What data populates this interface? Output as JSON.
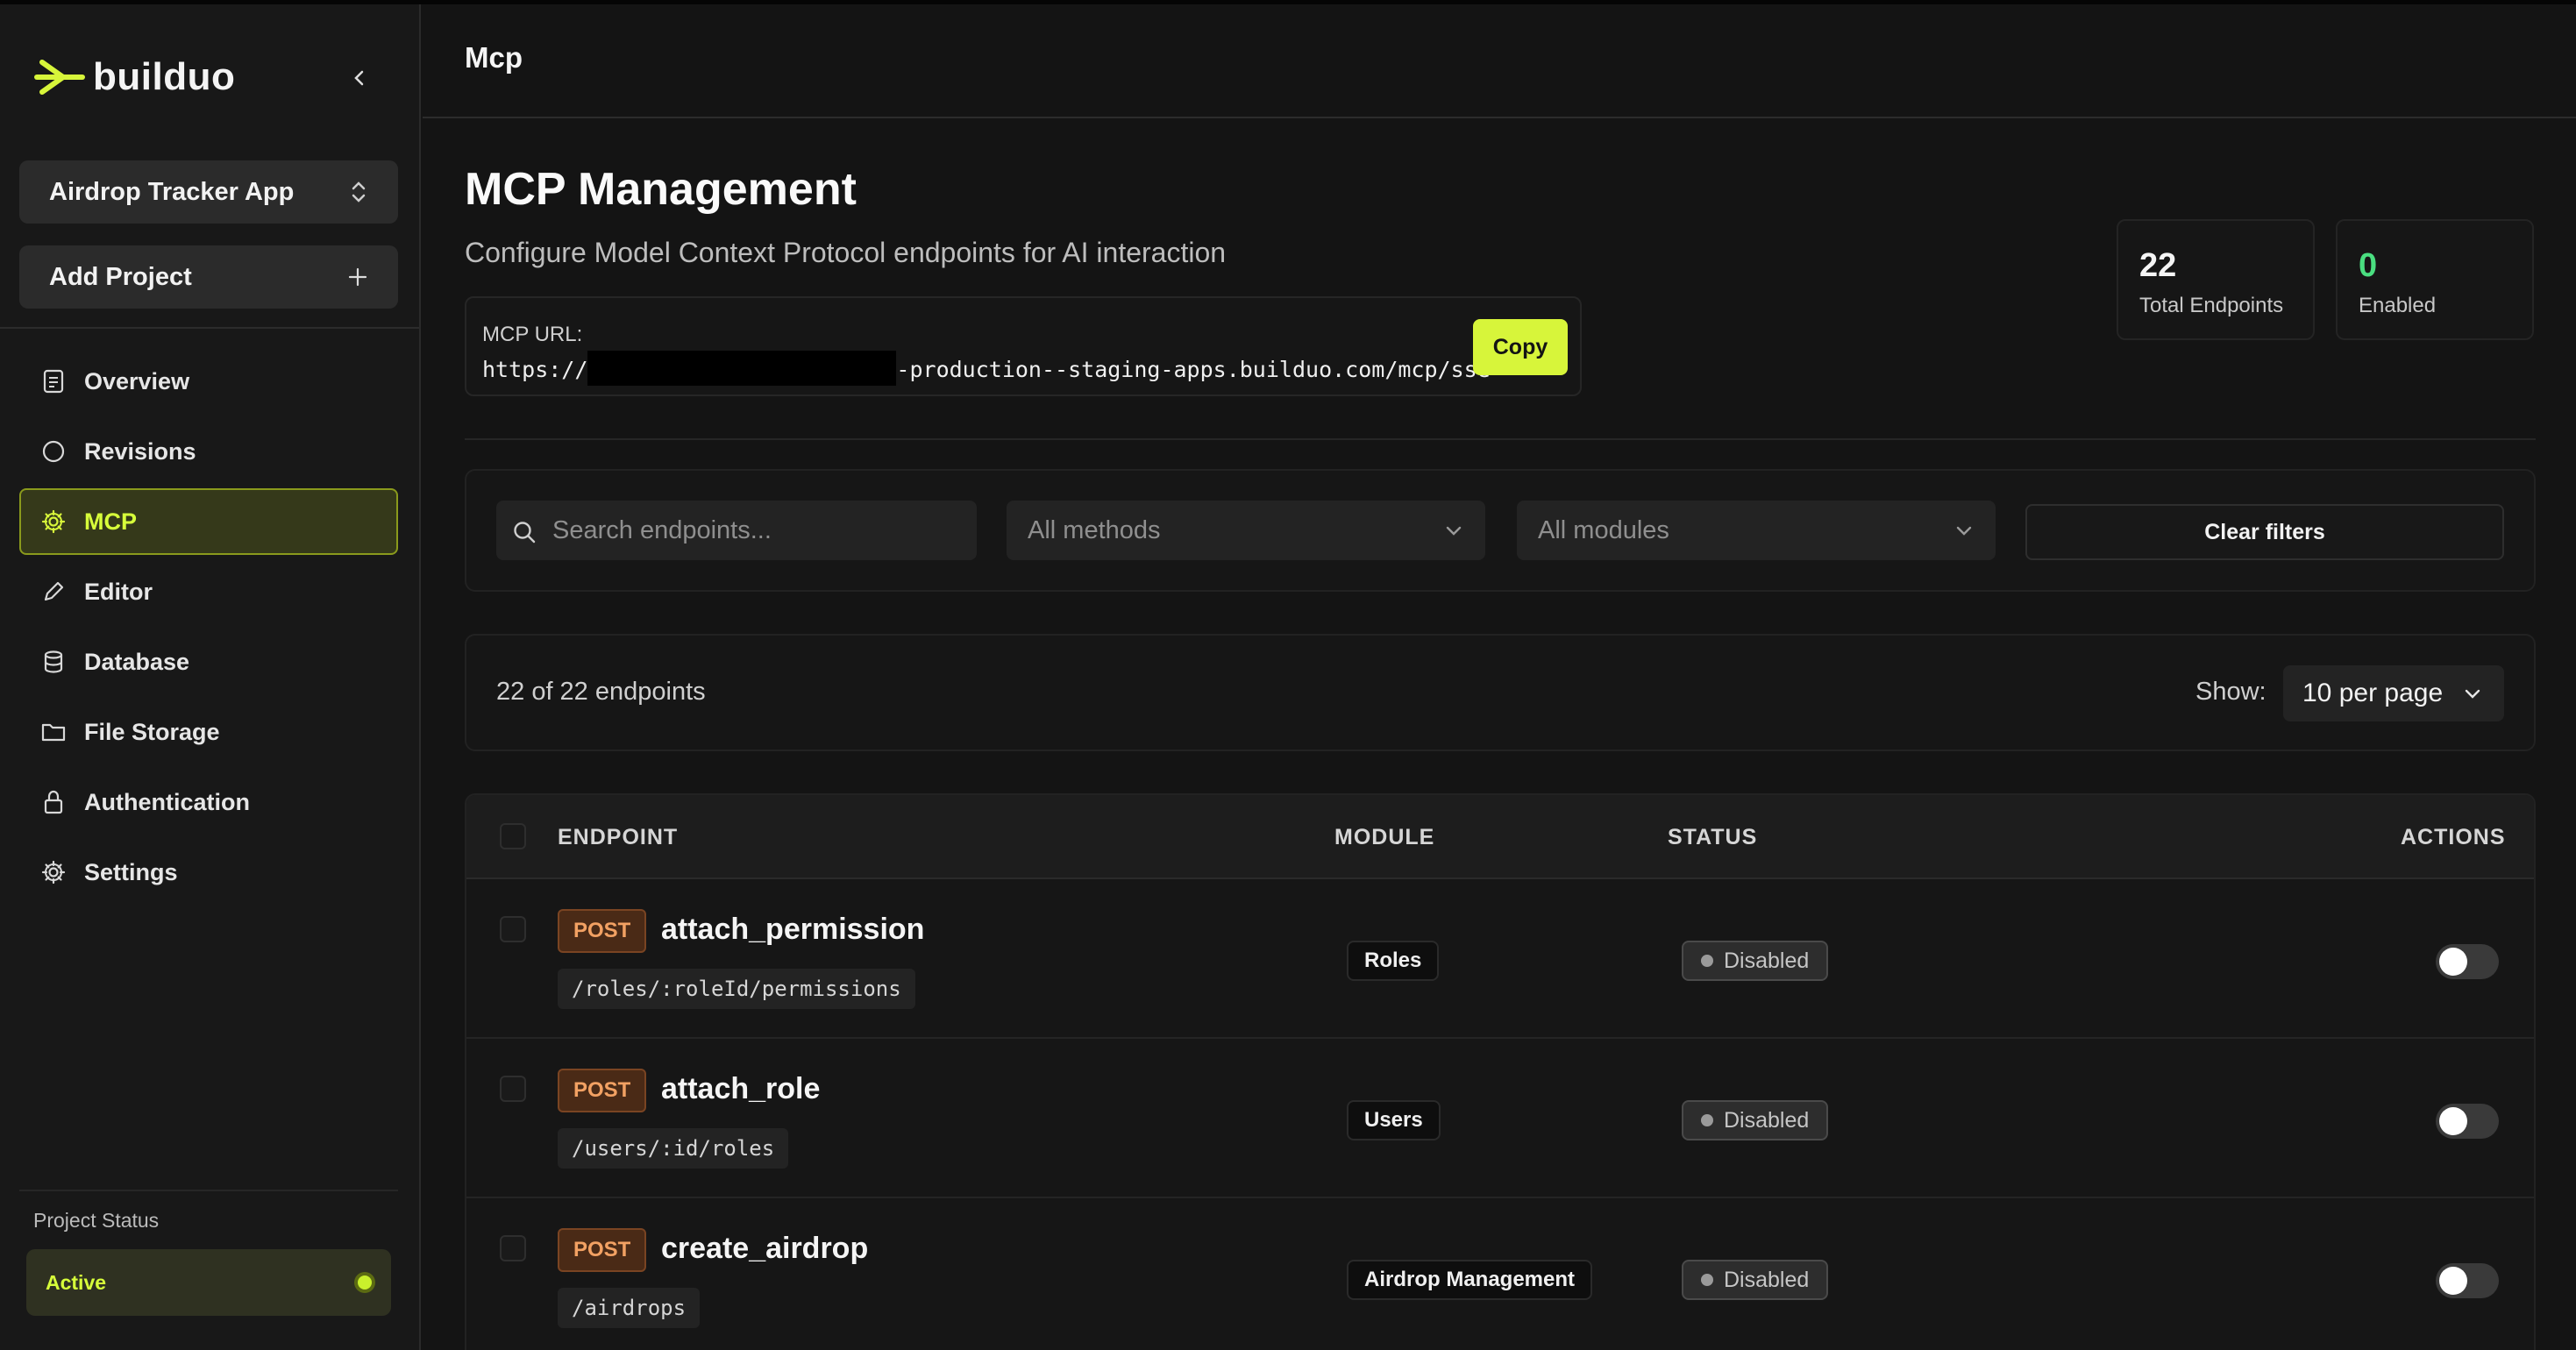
{
  "app": {
    "logo_text": "builduo"
  },
  "sidebar": {
    "project_selector": "Airdrop Tracker App",
    "add_project": "Add Project",
    "items": [
      {
        "label": "Overview",
        "icon": "document-icon"
      },
      {
        "label": "Revisions",
        "icon": "circle-icon"
      },
      {
        "label": "MCP",
        "icon": "gear-icon",
        "active": true
      },
      {
        "label": "Editor",
        "icon": "pencil-icon"
      },
      {
        "label": "Database",
        "icon": "database-icon"
      },
      {
        "label": "File Storage",
        "icon": "folder-icon"
      },
      {
        "label": "Authentication",
        "icon": "lock-icon"
      },
      {
        "label": "Settings",
        "icon": "gear-icon"
      }
    ],
    "project_status_label": "Project Status",
    "project_status_value": "Active"
  },
  "header": {
    "title": "Mcp"
  },
  "main": {
    "title": "MCP Management",
    "subtitle": "Configure Model Context Protocol endpoints for AI interaction",
    "mcp_url_label": "MCP URL:",
    "mcp_url_prefix": "https://",
    "mcp_url_suffix": "-production--staging-apps.builduo.com/mcp/sse",
    "copy_label": "Copy",
    "stats": {
      "total": {
        "value": "22",
        "label": "Total Endpoints"
      },
      "enabled": {
        "value": "0",
        "label": "Enabled"
      }
    }
  },
  "filters": {
    "search_placeholder": "Search endpoints...",
    "methods": "All methods",
    "modules": "All modules",
    "clear": "Clear filters"
  },
  "list": {
    "count_text": "22 of 22 endpoints",
    "show_label": "Show:",
    "per_page": "10 per page"
  },
  "table": {
    "columns": {
      "endpoint": "ENDPOINT",
      "module": "MODULE",
      "status": "STATUS",
      "actions": "ACTIONS"
    },
    "rows": [
      {
        "method": "POST",
        "name": "attach_permission",
        "path": "/roles/:roleId/permissions",
        "module": "Roles",
        "status": "Disabled"
      },
      {
        "method": "POST",
        "name": "attach_role",
        "path": "/users/:id/roles",
        "module": "Users",
        "status": "Disabled"
      },
      {
        "method": "POST",
        "name": "create_airdrop",
        "path": "/airdrops",
        "module": "Airdrop Management",
        "status": "Disabled"
      }
    ]
  },
  "colors": {
    "accent": "#d7f53a",
    "method_post": "#f2a163",
    "enabled_green": "#4ade80"
  }
}
